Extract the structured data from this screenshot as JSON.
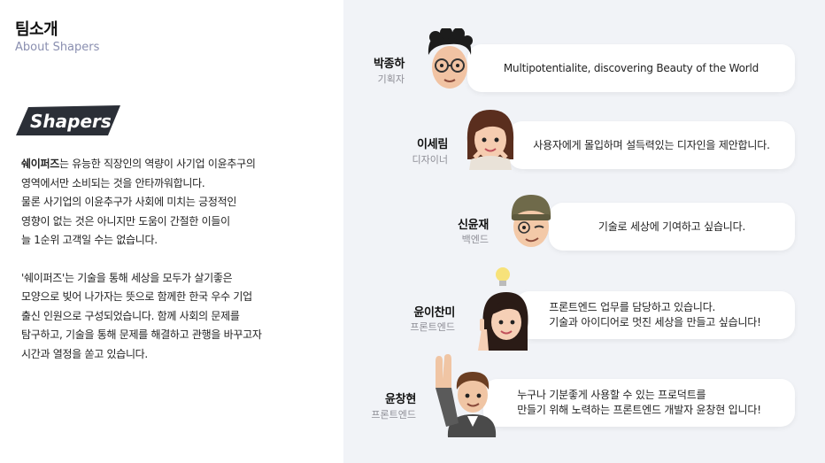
{
  "header": {
    "title": "팀소개",
    "subtitle": "About Shapers"
  },
  "logo": {
    "text": "Shapers"
  },
  "intro": {
    "brand": "쉐이퍼즈",
    "paragraph1_rest": "는 유능한 직장인의 역량이 사기업 이윤추구의\n영역에서만 소비되는 것을 안타까워합니다.\n물론 사기업의 이윤추구가 사회에 미치는 긍정적인\n영향이 없는 것은 아니지만 도움이 간절한 이들이\n늘 1순위 고객일 수는 없습니다.",
    "paragraph2": "'쉐이퍼즈'는 기술을 통해 세상을 모두가 살기좋은\n모양으로 빚어 나가자는 뜻으로 함께한 한국 우수 기업\n출신 인원으로 구성되었습니다. 함께 사회의 문제를\n탐구하고, 기술을 통해 문제를 해결하고 관행을 바꾸고자\n시간과 열정을 쏟고 있습니다."
  },
  "members": [
    {
      "name": "박종하",
      "role": "기획자",
      "message": "Multipotentialite, discovering Beauty of the World",
      "avatar_icon": "man-glasses-avatar-icon"
    },
    {
      "name": "이세림",
      "role": "디자이너",
      "message": "사용자에게 몰입하며 설득력있는 디자인을 제안합니다.",
      "avatar_icon": "woman-chin-rest-avatar-icon"
    },
    {
      "name": "신윤재",
      "role": "백엔드",
      "message": "기술로 세상에 기여하고 싶습니다.",
      "avatar_icon": "man-beanie-wink-avatar-icon"
    },
    {
      "name": "윤이찬미",
      "role": "프론트엔드",
      "message": "프론트엔드 업무를 담당하고 있습니다.\n기술과 아이디어로 멋진 세상을 만들고 싶습니다!",
      "avatar_icon": "woman-lightbulb-avatar-icon"
    },
    {
      "name": "윤창현",
      "role": "프론트엔드",
      "message": "누구나 기분좋게 사용할 수 있는 프로덕트를\n만들기 위해 노력하는 프론트엔드 개발자 윤창현 입니다!",
      "avatar_icon": "man-waving-avatar-icon"
    }
  ],
  "colors": {
    "panel_bg": "#f1f3f7",
    "subtitle": "#8a8fb0",
    "logo_bg": "#2b2f37"
  }
}
